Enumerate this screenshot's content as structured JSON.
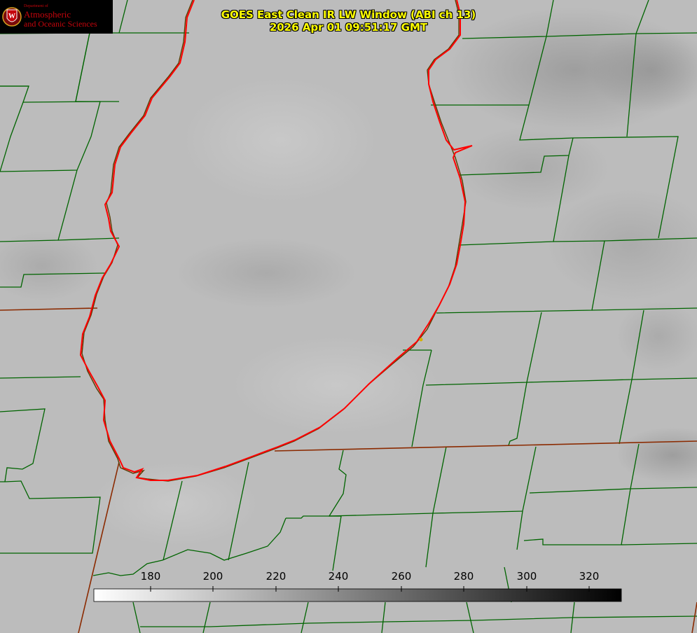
{
  "logo": {
    "department": "Department of",
    "line1": "Atmospheric",
    "line2": "and Oceanic Sciences"
  },
  "title": {
    "line1": "GOES East Clean IR LW Window (ABI ch 13)",
    "line2": "2026 Apr 01 09:51:17 GMT"
  },
  "colorbar": {
    "ticks": [
      "180",
      "200",
      "220",
      "240",
      "260",
      "280",
      "300",
      "320"
    ],
    "gradient_start": "#ffffff",
    "gradient_end": "#000000"
  },
  "colors": {
    "background": "#bcbcbc",
    "lake_outline": "#ff0000",
    "county_lines": "#006400",
    "state_lines": "#8b2a00",
    "marker": "#d4b000",
    "title_text": "#ffff00",
    "logo_red": "#c5050c"
  }
}
